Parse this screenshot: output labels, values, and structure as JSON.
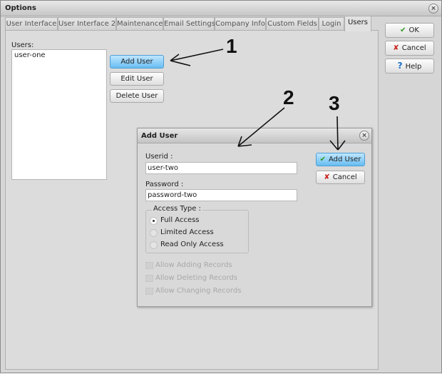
{
  "window": {
    "title": "Options",
    "close_icon": "close-icon"
  },
  "tabs": [
    {
      "label": "User Interface"
    },
    {
      "label": "User Interface 2"
    },
    {
      "label": "Maintenance"
    },
    {
      "label": "Email Settings"
    },
    {
      "label": "Company Info"
    },
    {
      "label": "Custom Fields"
    },
    {
      "label": "Login"
    },
    {
      "label": "Users",
      "active": true
    }
  ],
  "side_buttons": {
    "ok": "OK",
    "cancel": "Cancel",
    "help": "Help"
  },
  "users": {
    "label": "Users:",
    "items": [
      "user-one"
    ],
    "add": "Add User",
    "edit": "Edit User",
    "delete": "Delete User"
  },
  "dialog": {
    "title": "Add User",
    "userid_label": "Userid :",
    "userid_value": "user-two",
    "password_label": "Password :",
    "password_value": "password-two",
    "access_legend": "Access Type :",
    "access_options": [
      {
        "label": "Full Access",
        "selected": true
      },
      {
        "label": "Limited Access",
        "selected": false
      },
      {
        "label": "Read Only Access",
        "selected": false
      }
    ],
    "checkboxes": [
      {
        "label": "Allow Adding Records",
        "disabled": true
      },
      {
        "label": "Allow Deleting Records",
        "disabled": true
      },
      {
        "label": "Allow Changing Records",
        "disabled": true
      }
    ],
    "add": "Add User",
    "cancel": "Cancel"
  },
  "annotations": [
    "1",
    "2",
    "3"
  ],
  "colors": {
    "accent": "#68bdf2",
    "ok_check": "#2e9a1e",
    "cancel_x": "#c8201a",
    "help": "#1a6fc8"
  }
}
